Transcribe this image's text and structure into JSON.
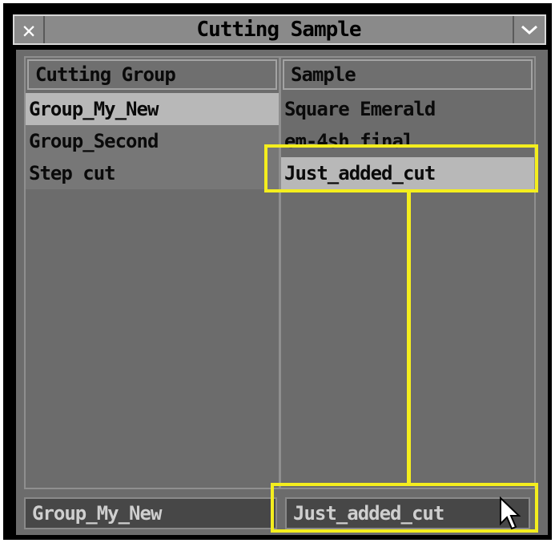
{
  "window": {
    "title": "Cutting Sample"
  },
  "left_panel": {
    "header": "Cutting Group",
    "items": [
      {
        "label": "Group_My_New",
        "selected": true
      },
      {
        "label": "Group_Second",
        "selected": false
      },
      {
        "label": "Step cut",
        "selected": false
      }
    ],
    "status": "Group_My_New"
  },
  "right_panel": {
    "header": "Sample",
    "items": [
      {
        "label": "Square Emerald",
        "selected": false
      },
      {
        "label": "em-4sh final",
        "selected": false
      },
      {
        "label": "Just_added_cut",
        "selected": true
      }
    ],
    "status": "Just_added_cut"
  },
  "colors": {
    "window_bg": "#6c6c6c",
    "highlight": "#f4ee1e",
    "selected_row": "#b8b8b8"
  },
  "icons": [
    "close-icon",
    "chevron-down-icon",
    "mouse-pointer-icon"
  ]
}
